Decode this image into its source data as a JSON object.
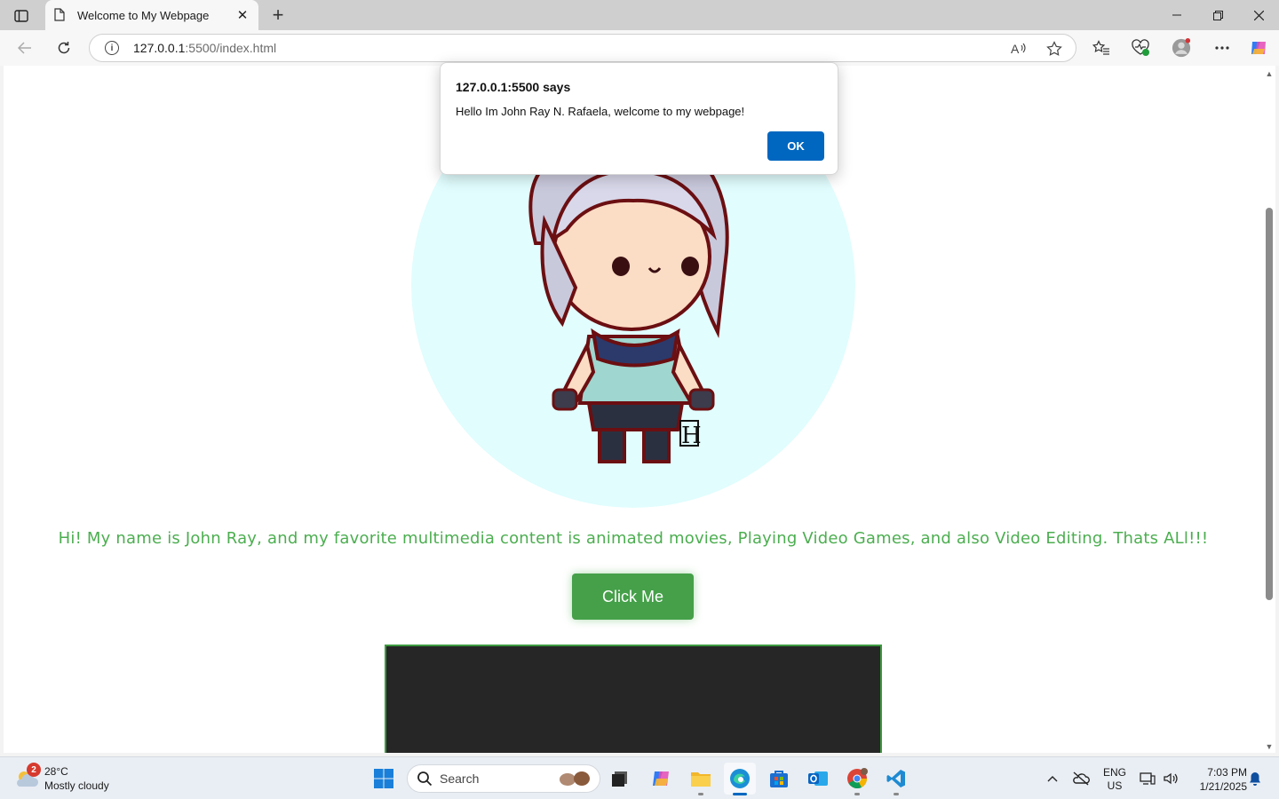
{
  "browser": {
    "tab_title": "Welcome to My Webpage",
    "url_host": "127.0.0.1",
    "url_path": ":5500/index.html"
  },
  "page": {
    "intro_text": "Hi! My name is John Ray, and my favorite multimedia content is animated movies, Playing Video Games, and also Video Editing. Thats ALl!!!",
    "button_label": "Click Me",
    "accent_color": "#4cae50",
    "circle_color": "#e1fdfe"
  },
  "alert": {
    "title": "127.0.0.1:5500 says",
    "message": "Hello Im John Ray N. Rafaela, welcome to my webpage!",
    "ok_label": "OK"
  },
  "taskbar": {
    "weather_badge": "2",
    "temperature": "28°C",
    "condition": "Mostly cloudy",
    "search_placeholder": "Search",
    "lang_primary": "ENG",
    "lang_secondary": "US",
    "time": "7:03 PM",
    "date": "1/21/2025"
  }
}
